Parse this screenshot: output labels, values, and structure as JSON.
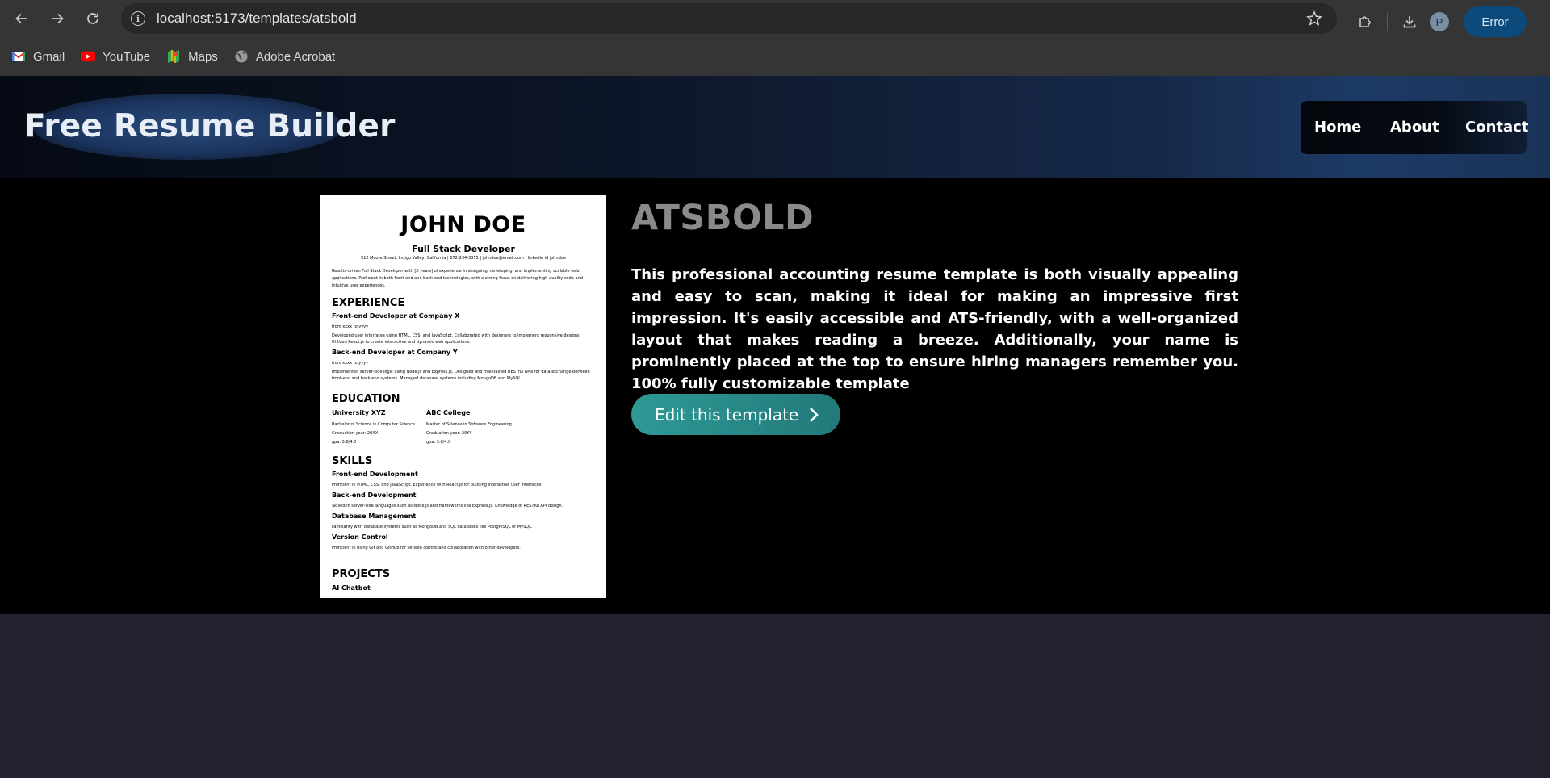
{
  "browser": {
    "url": "localhost:5173/templates/atsbold",
    "profile_initial": "P",
    "error_label": "Error",
    "bookmarks": [
      {
        "label": "Gmail",
        "icon": "gmail-icon"
      },
      {
        "label": "YouTube",
        "icon": "youtube-icon"
      },
      {
        "label": "Maps",
        "icon": "maps-icon"
      },
      {
        "label": "Adobe Acrobat",
        "icon": "globe-icon"
      }
    ]
  },
  "header": {
    "logo": "Free Resume Builder",
    "nav": {
      "home": "Home",
      "about": "About",
      "contact": "Contact"
    }
  },
  "resume": {
    "name": "JOHN DOE",
    "role": "Full Stack Developer",
    "contact": "512 Moore Street, Indigo Valley, California | 872-234-3355 | johndoe@email.com | linkedin id johndoe",
    "summary": "Results-driven Full Stack Developer with [X years] of experience in designing, developing, and implementing scalable web applications. Proficient in both front-end and back-end technologies, with a strong focus on delivering high-quality code and intuitive user experiences.",
    "experience_heading": "EXPERIENCE",
    "job1_title": "Front-end Developer at Company X",
    "job1_dates": "from xxxx to yyyy",
    "job1_desc": "Developed user interfaces using HTML, CSS, and JavaScript. Collaborated with designers to implement responsive designs. Utilized React.js to create interactive and dynamic web applications.",
    "job2_title": "Back-end Developer at Company Y",
    "job2_dates": "from xxxx to yyyy",
    "job2_desc": "Implemented server-side logic using Node.js and Express.js. Designed and maintained RESTful APIs for data exchange between front-end and back-end systems. Managed database systems including MongoDB and MySQL.",
    "education_heading": "EDUCATION",
    "edu1_school": "University XYZ",
    "edu1_degree": "Bachelor of Science in Computer Science",
    "edu1_year": "Graduation year: 20XX",
    "edu1_gpa": "gpa: 3.8/4.0",
    "edu2_school": "ABC College",
    "edu2_degree": "Master of Science in Software Engineering",
    "edu2_year": "Graduation year: 20YY",
    "edu2_gpa": "gpa: 3.8/4.0",
    "skills_heading": "SKILLS",
    "skill1_title": "Front-end Development",
    "skill1_desc": "Proficient in HTML, CSS, and JavaScript. Experience with React.js for building interactive user interfaces.",
    "skill2_title": "Back-end Development",
    "skill2_desc": "Skilled in server-side languages such as Node.js and frameworks like Express.js. Knowledge of RESTful API design.",
    "skill3_title": "Database Management",
    "skill3_desc": "Familiarity with database systems such as MongoDB and SQL databases like PostgreSQL or MySQL.",
    "skill4_title": "Version Control",
    "skill4_desc": "Proficient in using Git and GitHub for version control and collaboration with other developers.",
    "projects_heading": "PROJECTS",
    "project1_title": "AI Chatbot"
  },
  "template": {
    "title": "ATSBOLD",
    "description": "This professional accounting resume template is both visually appealing and easy to scan, making it ideal for making an impressive first impression. It's easily accessible and ATS-friendly, with a well-organized layout that makes reading a breeze. Additionally, your name is prominently placed at the top to ensure hiring managers remember you. 100% fully customizable template",
    "edit_button": "Edit this template"
  }
}
